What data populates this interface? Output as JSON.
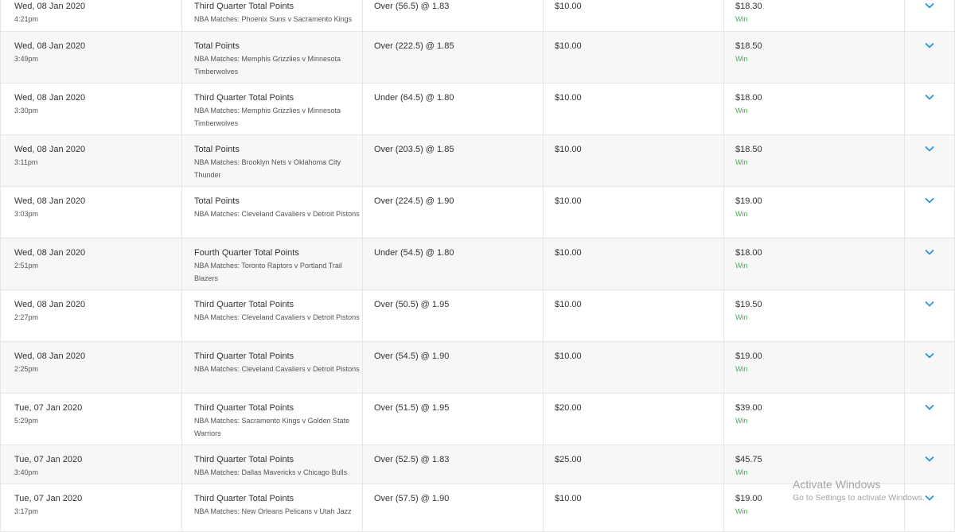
{
  "bets": [
    {
      "date": "Wed, 08 Jan 2020",
      "time": "4:21pm",
      "market": "Third Quarter Total Points",
      "event": "NBA Matches: Phoenix Suns v Sacramento Kings",
      "selection": "Over (56.5) @ 1.83",
      "stake": "$10.00",
      "return": "$18.30",
      "result": "Win"
    },
    {
      "date": "Wed, 08 Jan 2020",
      "time": "3:49pm",
      "market": "Total Points",
      "event": "NBA Matches: Memphis Grizzlies v Minnesota Timberwolves",
      "selection": "Over (222.5) @ 1.85",
      "stake": "$10.00",
      "return": "$18.50",
      "result": "Win"
    },
    {
      "date": "Wed, 08 Jan 2020",
      "time": "3:30pm",
      "market": "Third Quarter Total Points",
      "event": "NBA Matches: Memphis Grizzlies v Minnesota Timberwolves",
      "selection": "Under (64.5) @ 1.80",
      "stake": "$10.00",
      "return": "$18.00",
      "result": "Win"
    },
    {
      "date": "Wed, 08 Jan 2020",
      "time": "3:11pm",
      "market": "Total Points",
      "event": "NBA Matches: Brooklyn Nets v Oklahoma City Thunder",
      "selection": "Over (203.5) @ 1.85",
      "stake": "$10.00",
      "return": "$18.50",
      "result": "Win"
    },
    {
      "date": "Wed, 08 Jan 2020",
      "time": "3:03pm",
      "market": "Total Points",
      "event": "NBA Matches: Cleveland Cavaliers v Detroit Pistons",
      "selection": "Over (224.5) @ 1.90",
      "stake": "$10.00",
      "return": "$19.00",
      "result": "Win"
    },
    {
      "date": "Wed, 08 Jan 2020",
      "time": "2:51pm",
      "market": "Fourth Quarter Total Points",
      "event": "NBA Matches: Toronto Raptors v Portland Trail Blazers",
      "selection": "Under (54.5) @ 1.80",
      "stake": "$10.00",
      "return": "$18.00",
      "result": "Win"
    },
    {
      "date": "Wed, 08 Jan 2020",
      "time": "2:27pm",
      "market": "Third Quarter Total Points",
      "event": "NBA Matches: Cleveland Cavaliers v Detroit Pistons",
      "selection": "Over (50.5) @ 1.95",
      "stake": "$10.00",
      "return": "$19.50",
      "result": "Win"
    },
    {
      "date": "Wed, 08 Jan 2020",
      "time": "2:25pm",
      "market": "Third Quarter Total Points",
      "event": "NBA Matches: Cleveland Cavaliers v Detroit Pistons",
      "selection": "Over (54.5) @ 1.90",
      "stake": "$10.00",
      "return": "$19.00",
      "result": "Win"
    },
    {
      "date": "Tue, 07 Jan 2020",
      "time": "5:29pm",
      "market": "Third Quarter Total Points",
      "event": "NBA Matches: Sacramento Kings v Golden State Warriors",
      "selection": "Over (51.5) @ 1.95",
      "stake": "$20.00",
      "return": "$39.00",
      "result": "Win"
    },
    {
      "date": "Tue, 07 Jan 2020",
      "time": "3:40pm",
      "market": "Third Quarter Total Points",
      "event": "NBA Matches: Dallas Mavericks v Chicago Bulls",
      "selection": "Over (52.5) @ 1.83",
      "stake": "$25.00",
      "return": "$45.75",
      "result": "Win"
    },
    {
      "date": "Tue, 07 Jan 2020",
      "time": "3:17pm",
      "market": "Third Quarter Total Points",
      "event": "NBA Matches: New Orleans Pelicans v Utah Jazz",
      "selection": "Over (57.5) @ 1.90",
      "stake": "$10.00",
      "return": "$19.00",
      "result": "Win"
    }
  ],
  "watermark": {
    "title": "Activate Windows",
    "subtitle": "Go to Settings to activate Windows."
  },
  "icons": {
    "expand": "chevron-down-icon"
  },
  "colors": {
    "win": "#3bb54a",
    "chevron": "#1e90d6",
    "row_alt": "#f7f7f8",
    "border": "#e6e6e6"
  }
}
